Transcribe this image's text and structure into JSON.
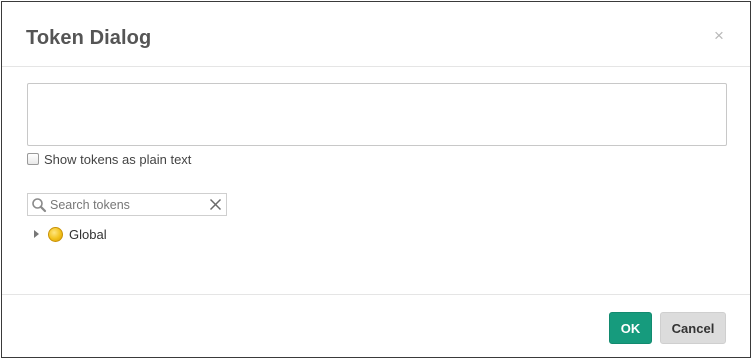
{
  "dialog": {
    "title": "Token Dialog",
    "close_glyph": "×"
  },
  "token_input": {
    "value": ""
  },
  "plain_text_option": {
    "label": "Show tokens as plain text",
    "checked": false
  },
  "search": {
    "placeholder": "Search tokens",
    "value": "",
    "icon": "search-icon",
    "clear_icon": "clear-icon"
  },
  "tree": {
    "items": [
      {
        "label": "Global",
        "icon": "coin-icon",
        "expanded": false
      }
    ]
  },
  "footer": {
    "ok_label": "OK",
    "cancel_label": "Cancel"
  },
  "colors": {
    "primary": "#169b7d",
    "secondary": "#dcdcdc",
    "title": "#555555"
  }
}
